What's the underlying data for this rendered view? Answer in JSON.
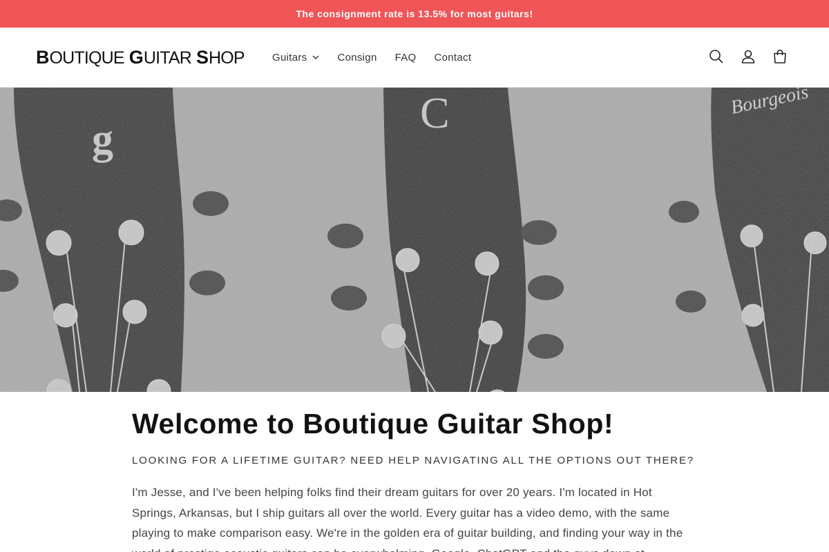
{
  "announcement": "The consignment rate is 13.5% for most guitars!",
  "brand": {
    "words": [
      {
        "initial": "B",
        "rest": "OUTIQUE"
      },
      {
        "initial": "G",
        "rest": "UITAR"
      },
      {
        "initial": "S",
        "rest": "HOP"
      }
    ]
  },
  "nav": {
    "items": [
      "Guitars",
      "Consign",
      "FAQ",
      "Contact"
    ]
  },
  "header_icons": [
    "search-icon",
    "account-icon",
    "cart-icon"
  ],
  "hero": {
    "headstock_logos": [
      "g",
      "C",
      "Bourgeois"
    ]
  },
  "main": {
    "title": "Welcome to Boutique Guitar Shop!",
    "subtitle": "LOOKING FOR A LIFETIME GUITAR? NEED HELP NAVIGATING ALL THE OPTIONS OUT THERE?",
    "body": "I'm Jesse, and I've been helping folks find their dream guitars for over 20 years. I'm located in Hot Springs, Arkansas, but I ship guitars all over the world. Every guitar has a video demo, with the same playing to make comparison easy. We're in the golden era of guitar building, and finding your way in the world of prestige acoustic guitars can be overwhelming. Google, ChatGPT and the guys down at"
  },
  "colors": {
    "announcement_bg": "#ef5557",
    "text": "#121212"
  }
}
